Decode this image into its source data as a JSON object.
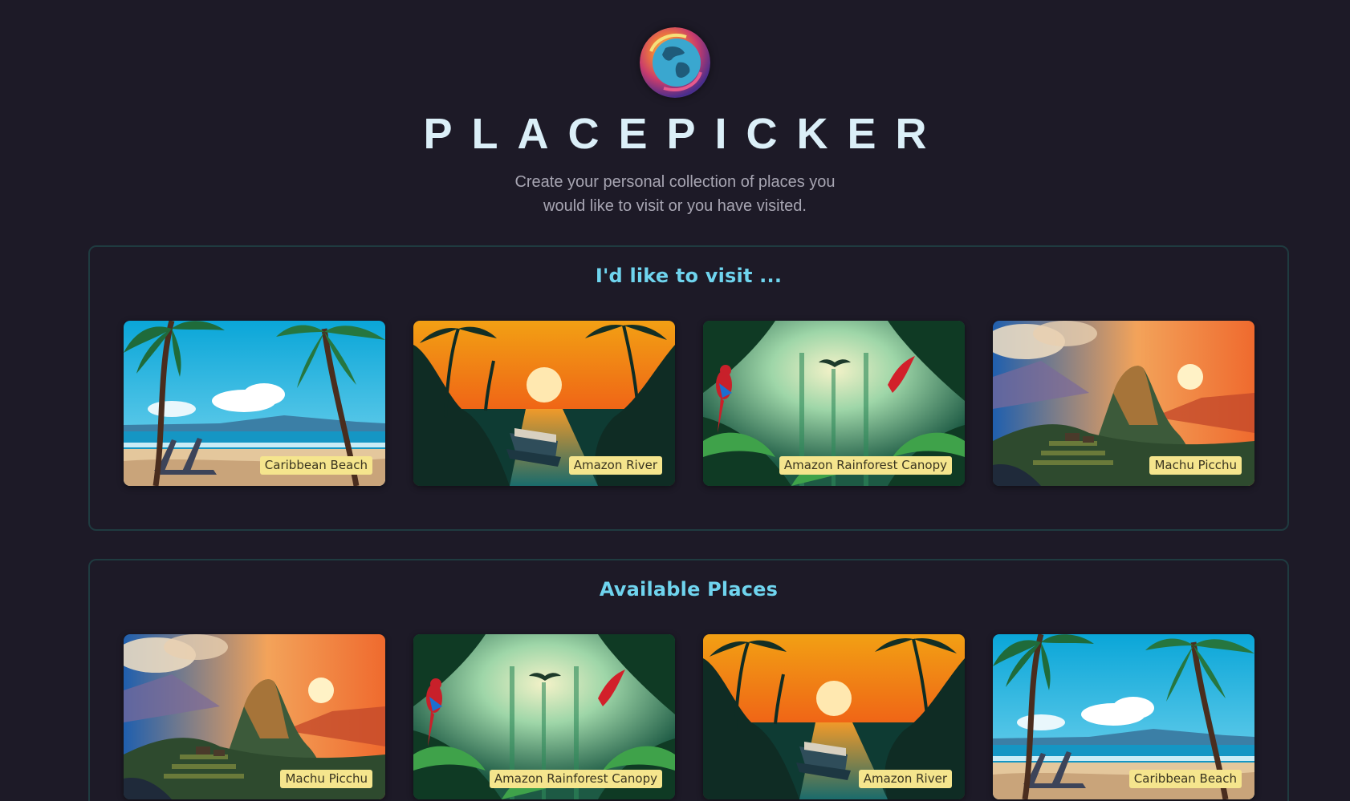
{
  "header": {
    "title": "PLACEPICKER",
    "subtitle": "Create your personal collection of places you would like to visit or you have visited.",
    "logo_icon": "globe-logo-icon"
  },
  "sections": [
    {
      "title": "I'd like to visit ...",
      "places": [
        {
          "name": "Caribbean Beach",
          "scene": "beach"
        },
        {
          "name": "Amazon River",
          "scene": "river"
        },
        {
          "name": "Amazon Rainforest Canopy",
          "scene": "canopy"
        },
        {
          "name": "Machu Picchu",
          "scene": "machu"
        }
      ]
    },
    {
      "title": "Available Places",
      "places": [
        {
          "name": "Machu Picchu",
          "scene": "machu"
        },
        {
          "name": "Amazon Rainforest Canopy",
          "scene": "canopy"
        },
        {
          "name": "Amazon River",
          "scene": "river"
        },
        {
          "name": "Caribbean Beach",
          "scene": "beach"
        }
      ]
    }
  ],
  "colors": {
    "background": "#1d1a27",
    "title": "#dbeff8",
    "section_heading": "#6fd4ee",
    "label_background": "#f5e58d",
    "section_border": "#1f3b40"
  }
}
